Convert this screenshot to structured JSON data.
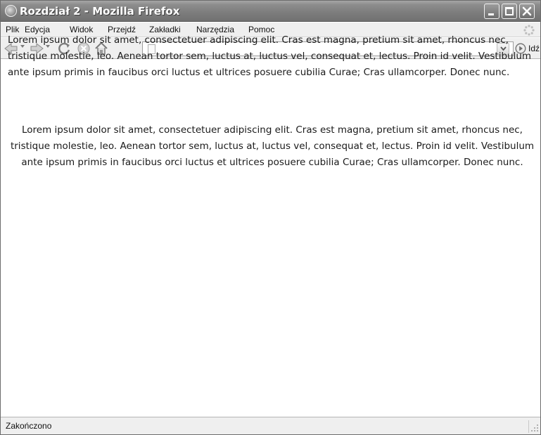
{
  "window": {
    "title": "Rozdział 2 - Mozilla Firefox"
  },
  "menu": {
    "items": [
      "Plik",
      "Edycja",
      "Widok",
      "Przejdź",
      "Zakładki",
      "Narzędzia",
      "Pomoc"
    ]
  },
  "toolbar": {
    "icons": [
      "back-icon",
      "forward-icon",
      "reload-icon",
      "stop-icon",
      "home-icon"
    ],
    "address_value": "",
    "go_label": "Idź"
  },
  "content": {
    "paragraphs": [
      "Lorem ipsum dolor sit amet, consectetuer adipiscing elit. Cras est magna, pretium sit amet, rhoncus nec, tristique molestie, leo. Aenean tortor sem, luctus at, luctus vel, consequat et, lectus. Proin id velit. Vestibulum ante ipsum primis in faucibus orci luctus et ultrices posuere cubilia Curae; Cras ullamcorper. Donec nunc.",
      "Lorem ipsum dolor sit amet, consectetuer adipiscing elit. Cras est magna, pretium sit amet, rhoncus nec, tristique molestie, leo. Aenean tortor sem, luctus at, luctus vel, consequat et, lectus. Proin id velit. Vestibulum ante ipsum primis in faucibus orci luctus et ultrices posuere cubilia Curae; Cras ullamcorper. Donec nunc."
    ]
  },
  "status": {
    "text": "Zakończono"
  },
  "colors": {
    "titlebar": "#7c7c7c",
    "chrome": "#efefef",
    "text": "#1a1a1a"
  }
}
